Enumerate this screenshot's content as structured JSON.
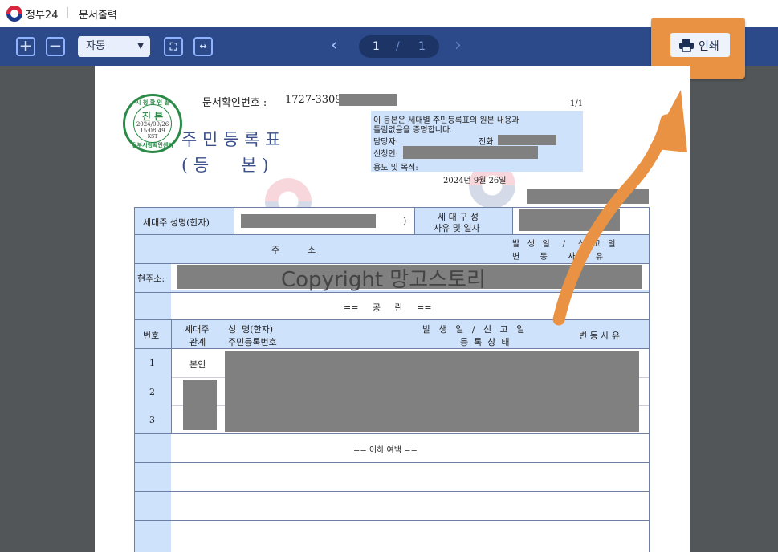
{
  "app": {
    "name": "정부24",
    "window_title": "문서출력"
  },
  "toolbar": {
    "zoom_mode": "자동",
    "page_current": "1",
    "page_separator": "/",
    "page_total": "1",
    "print_label": "인쇄"
  },
  "document": {
    "doc_number_label": "문서확인번호 :",
    "doc_number_visible": "1727-3309-",
    "page_indicator": "1/1",
    "title_line1": "주 민 등 록 표",
    "title_line2": "( 등      본 )",
    "notice_line1": "이 등본은 세대별 주민등록표의 원본 내용과",
    "notice_line2": "틀림없음을 증명합니다.",
    "manager_label": "담당자:",
    "phone_label": "전화",
    "applicant_label": "신청인:",
    "purpose_label": "용도 및 목적:",
    "issue_date": "2024년 9월 26일",
    "seal": {
      "top": "시 청 확 인 필",
      "main": "진 본",
      "date": "2024/09/26",
      "time": "15:08:49",
      "tz": "KST",
      "bottom": "정부시청확인센터"
    },
    "head_label": "세대주 성명(한자)",
    "head_paren": ")",
    "composition_label_1": "세 대 구 성",
    "composition_label_2": "사유 및 일자",
    "address_header": "주          소",
    "occur_header_1": "발   생   일     /     신   고   일",
    "occur_header_2": "변        동        사        유",
    "current_address_label": "현주소:",
    "watermark_text": "Copyright 망고스토리",
    "shared_header": "==     공     란     ==",
    "col_no": "번호",
    "col_relation_1": "세대주",
    "col_relation_2": "관계",
    "col_name_1": "성  명(한자)",
    "col_name_2": "주민등록번호",
    "col_occur_1": "발   생   일   /   신   고   일",
    "col_occur_2": "등  록  상  태",
    "col_change": "변 동 사 유",
    "rows": [
      {
        "no": "1",
        "relation": "본인"
      },
      {
        "no": "2",
        "relation": ""
      },
      {
        "no": "3",
        "relation": ""
      }
    ],
    "end_marker": "== 이하 여백 =="
  },
  "colors": {
    "toolbar": "#2c4a8a",
    "highlight": "#e99243",
    "table_blue": "#cfe2fb",
    "redaction": "#808080",
    "seal_green": "#2a8a47"
  }
}
